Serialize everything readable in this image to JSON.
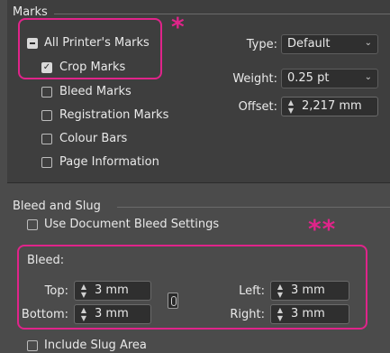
{
  "marks": {
    "section_title": "Marks",
    "all_printers_marks": "All Printer's Marks",
    "crop_marks": "Crop Marks",
    "bleed_marks": "Bleed Marks",
    "registration_marks": "Registration Marks",
    "colour_bars": "Colour Bars",
    "page_information": "Page Information",
    "type_label": "Type:",
    "type_value": "Default",
    "weight_label": "Weight:",
    "weight_value": "0.25 pt",
    "offset_label": "Offset:",
    "offset_value": "2,217 mm",
    "annotation": "*"
  },
  "bleed_slug": {
    "section_title": "Bleed and Slug",
    "use_document_bleed": "Use Document Bleed Settings",
    "bleed_label": "Bleed:",
    "top_label": "Top:",
    "top_value": "3 mm",
    "bottom_label": "Bottom:",
    "bottom_value": "3 mm",
    "left_label": "Left:",
    "left_value": "3 mm",
    "right_label": "Right:",
    "right_value": "3 mm",
    "include_slug": "Include Slug Area",
    "annotation": "**"
  },
  "colors": {
    "highlight": "#e0248a",
    "panel_bg": "#3e3e3e",
    "window_bg": "#4b4b4b"
  }
}
